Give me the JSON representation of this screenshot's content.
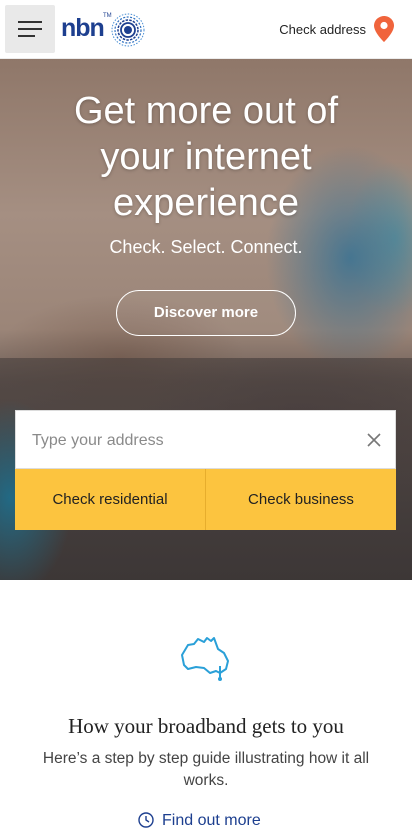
{
  "header": {
    "menu_icon": "hamburger-menu-icon",
    "logo_text": "nbn",
    "logo_tm": "TM",
    "check_address_label": "Check address",
    "pin_icon": "location-pin-icon",
    "pin_color": "#f0643c",
    "brand_color": "#1d3f8f"
  },
  "hero": {
    "title_line1": "Get more out of",
    "title_line2": "your internet",
    "title_line3": "experience",
    "subtitle": "Check. Select. Connect.",
    "discover_label": "Discover more"
  },
  "address_search": {
    "placeholder": "Type your address",
    "value": "",
    "clear_icon": "close-icon",
    "residential_label": "Check residential",
    "business_label": "Check business",
    "button_color": "#fcc43f"
  },
  "info": {
    "icon": "australia-map-pin-icon",
    "icon_color": "#2aa0d8",
    "heading": "How your broadband gets to you",
    "description": "Here’s a step by step guide illustrating how it all works.",
    "link_label": "Find out more",
    "link_icon": "clock-icon"
  }
}
